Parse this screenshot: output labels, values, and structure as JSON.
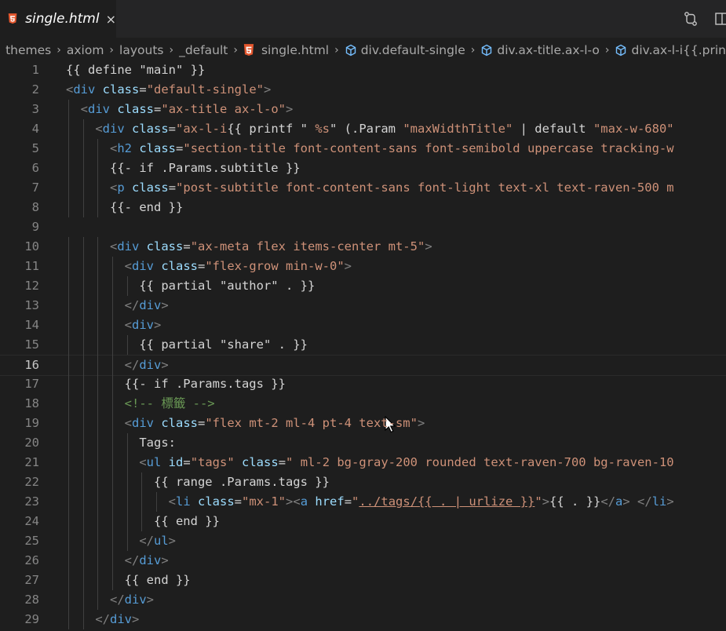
{
  "tab": {
    "label": "single.html",
    "close": "×"
  },
  "breadcrumb": [
    "themes",
    "axiom",
    "layouts",
    "_default",
    "single.html",
    "div.default-single",
    "div.ax-title.ax-l-o",
    "div.ax-l-i{{.prin"
  ],
  "active_line": 16,
  "lines": [
    {
      "n": "1",
      "t": [
        [
          "tpl",
          "{{ define \"main\" }}"
        ]
      ]
    },
    {
      "n": "2",
      "t": [
        [
          "br",
          "<"
        ],
        [
          "tag",
          "div"
        ],
        [
          "attr",
          " class"
        ],
        [
          "tpl",
          "="
        ],
        [
          "str",
          "\"default-single\""
        ],
        [
          "br",
          ">"
        ]
      ]
    },
    {
      "n": "3",
      "t": [
        [
          "tpl",
          "  "
        ],
        [
          "br",
          "<"
        ],
        [
          "tag",
          "div"
        ],
        [
          "attr",
          " class"
        ],
        [
          "tpl",
          "="
        ],
        [
          "str",
          "\"ax-title ax-l-o\""
        ],
        [
          "br",
          ">"
        ]
      ]
    },
    {
      "n": "4",
      "t": [
        [
          "tpl",
          "    "
        ],
        [
          "br",
          "<"
        ],
        [
          "tag",
          "div"
        ],
        [
          "attr",
          " class"
        ],
        [
          "tpl",
          "="
        ],
        [
          "str",
          "\"ax-l-i"
        ],
        [
          "tpl",
          "{{ printf \" "
        ],
        [
          "str",
          "%s"
        ],
        [
          "tpl",
          "\" (.Param "
        ],
        [
          "str",
          "\"maxWidthTitle\""
        ],
        [
          "tpl",
          " | default "
        ],
        [
          "str",
          "\"max-w-680\""
        ]
      ]
    },
    {
      "n": "5",
      "t": [
        [
          "tpl",
          "      "
        ],
        [
          "br",
          "<"
        ],
        [
          "tag",
          "h2"
        ],
        [
          "attr",
          " class"
        ],
        [
          "tpl",
          "="
        ],
        [
          "str",
          "\"section-title font-content-sans font-semibold uppercase tracking-w"
        ]
      ]
    },
    {
      "n": "6",
      "t": [
        [
          "tpl",
          "      {{- if .Params.subtitle }}"
        ]
      ]
    },
    {
      "n": "7",
      "t": [
        [
          "tpl",
          "      "
        ],
        [
          "br",
          "<"
        ],
        [
          "tag",
          "p"
        ],
        [
          "attr",
          " class"
        ],
        [
          "tpl",
          "="
        ],
        [
          "str",
          "\"post-subtitle font-content-sans font-light text-xl text-raven-500 m"
        ]
      ]
    },
    {
      "n": "8",
      "t": [
        [
          "tpl",
          "      {{- end }}"
        ]
      ]
    },
    {
      "n": "9",
      "t": [
        [
          "tpl",
          ""
        ]
      ]
    },
    {
      "n": "10",
      "t": [
        [
          "tpl",
          "      "
        ],
        [
          "br",
          "<"
        ],
        [
          "tag",
          "div"
        ],
        [
          "attr",
          " class"
        ],
        [
          "tpl",
          "="
        ],
        [
          "str",
          "\"ax-meta flex items-center mt-5\""
        ],
        [
          "br",
          ">"
        ]
      ]
    },
    {
      "n": "11",
      "t": [
        [
          "tpl",
          "        "
        ],
        [
          "br",
          "<"
        ],
        [
          "tag",
          "div"
        ],
        [
          "attr",
          " class"
        ],
        [
          "tpl",
          "="
        ],
        [
          "str",
          "\"flex-grow min-w-0\""
        ],
        [
          "br",
          ">"
        ]
      ]
    },
    {
      "n": "12",
      "t": [
        [
          "tpl",
          "          {{ partial \"author\" . }}"
        ]
      ]
    },
    {
      "n": "13",
      "t": [
        [
          "tpl",
          "        "
        ],
        [
          "br",
          "</"
        ],
        [
          "tag",
          "div"
        ],
        [
          "br",
          ">"
        ]
      ]
    },
    {
      "n": "14",
      "t": [
        [
          "tpl",
          "        "
        ],
        [
          "br",
          "<"
        ],
        [
          "tag",
          "div"
        ],
        [
          "br",
          ">"
        ]
      ]
    },
    {
      "n": "15",
      "t": [
        [
          "tpl",
          "          {{ partial \"share\" . }}"
        ]
      ]
    },
    {
      "n": "16",
      "t": [
        [
          "tpl",
          "        "
        ],
        [
          "br",
          "</"
        ],
        [
          "tag",
          "div"
        ],
        [
          "br",
          ">"
        ]
      ]
    },
    {
      "n": "17",
      "t": [
        [
          "tpl",
          "        {{- if .Params.tags }}"
        ]
      ]
    },
    {
      "n": "18",
      "t": [
        [
          "tpl",
          "        "
        ],
        [
          "cmt",
          "<!-- 標籤 -->"
        ]
      ]
    },
    {
      "n": "19",
      "t": [
        [
          "tpl",
          "        "
        ],
        [
          "br",
          "<"
        ],
        [
          "tag",
          "div"
        ],
        [
          "attr",
          " class"
        ],
        [
          "tpl",
          "="
        ],
        [
          "str",
          "\"flex mt-2 ml-4 pt-4 text-sm\""
        ],
        [
          "br",
          ">"
        ]
      ]
    },
    {
      "n": "20",
      "t": [
        [
          "tpl",
          "          Tags:"
        ]
      ]
    },
    {
      "n": "21",
      "t": [
        [
          "tpl",
          "          "
        ],
        [
          "br",
          "<"
        ],
        [
          "tag",
          "ul"
        ],
        [
          "attr",
          " id"
        ],
        [
          "tpl",
          "="
        ],
        [
          "str",
          "\"tags\""
        ],
        [
          "attr",
          " class"
        ],
        [
          "tpl",
          "="
        ],
        [
          "str",
          "\" ml-2 bg-gray-200 rounded text-raven-700 bg-raven-10"
        ]
      ]
    },
    {
      "n": "22",
      "t": [
        [
          "tpl",
          "            {{ range .Params.tags }}"
        ]
      ]
    },
    {
      "n": "23",
      "t": [
        [
          "tpl",
          "              "
        ],
        [
          "br",
          "<"
        ],
        [
          "tag",
          "li"
        ],
        [
          "attr",
          " class"
        ],
        [
          "tpl",
          "="
        ],
        [
          "str",
          "\"mx-1\""
        ],
        [
          "br",
          "><"
        ],
        [
          "tag",
          "a"
        ],
        [
          "attr",
          " href"
        ],
        [
          "tpl",
          "="
        ],
        [
          "str",
          "\""
        ],
        [
          "str link",
          "../tags/{{ . | urlize }}"
        ],
        [
          "str",
          "\""
        ],
        [
          "br",
          ">"
        ],
        [
          "tpl",
          "{{ . }}"
        ],
        [
          "br",
          "</"
        ],
        [
          "tag",
          "a"
        ],
        [
          "br",
          "> </"
        ],
        [
          "tag",
          "li"
        ],
        [
          "br",
          ">"
        ]
      ]
    },
    {
      "n": "24",
      "t": [
        [
          "tpl",
          "            {{ end }}"
        ]
      ]
    },
    {
      "n": "25",
      "t": [
        [
          "tpl",
          "          "
        ],
        [
          "br",
          "</"
        ],
        [
          "tag",
          "ul"
        ],
        [
          "br",
          ">"
        ]
      ]
    },
    {
      "n": "26",
      "t": [
        [
          "tpl",
          "        "
        ],
        [
          "br",
          "</"
        ],
        [
          "tag",
          "div"
        ],
        [
          "br",
          ">"
        ]
      ]
    },
    {
      "n": "27",
      "t": [
        [
          "tpl",
          "        {{ end }}"
        ]
      ]
    },
    {
      "n": "28",
      "t": [
        [
          "tpl",
          "      "
        ],
        [
          "br",
          "</"
        ],
        [
          "tag",
          "div"
        ],
        [
          "br",
          ">"
        ]
      ]
    },
    {
      "n": "29",
      "t": [
        [
          "tpl",
          "    "
        ],
        [
          "br",
          "</"
        ],
        [
          "tag",
          "div"
        ],
        [
          "br",
          ">"
        ]
      ]
    }
  ]
}
